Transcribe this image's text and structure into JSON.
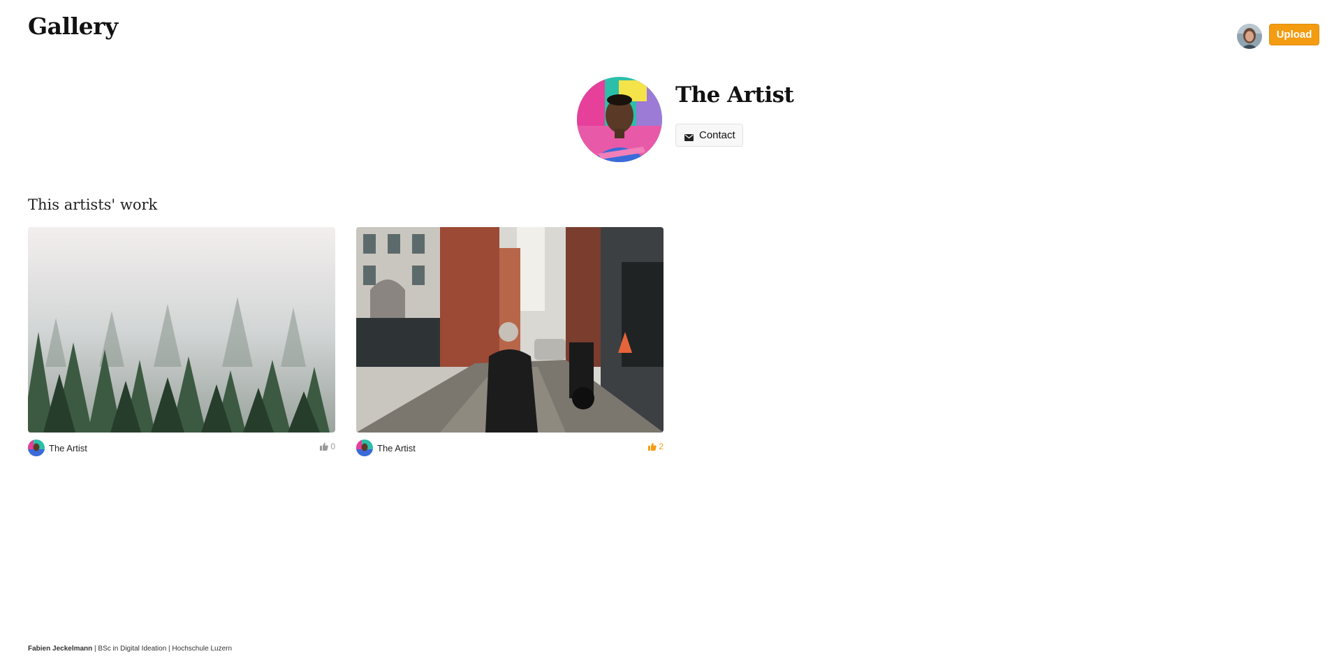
{
  "header": {
    "logo": "Gallery",
    "upload_label": "Upload"
  },
  "profile": {
    "name": "The Artist",
    "contact_label": "Contact"
  },
  "section": {
    "title": "This artists' work"
  },
  "works": [
    {
      "author": "The Artist",
      "likes": "0",
      "liked": false,
      "image": "foggy-forest-photo"
    },
    {
      "author": "The Artist",
      "likes": "2",
      "liked": true,
      "image": "city-alley-photo"
    }
  ],
  "footer": {
    "author": "Fabien Jeckelmann",
    "separator1": " | ",
    "program": "BSc in Digital Ideation",
    "separator2": " | ",
    "school": "Hochschule Luzern"
  },
  "colors": {
    "accent": "#f39c12",
    "like_inactive": "#999999"
  }
}
